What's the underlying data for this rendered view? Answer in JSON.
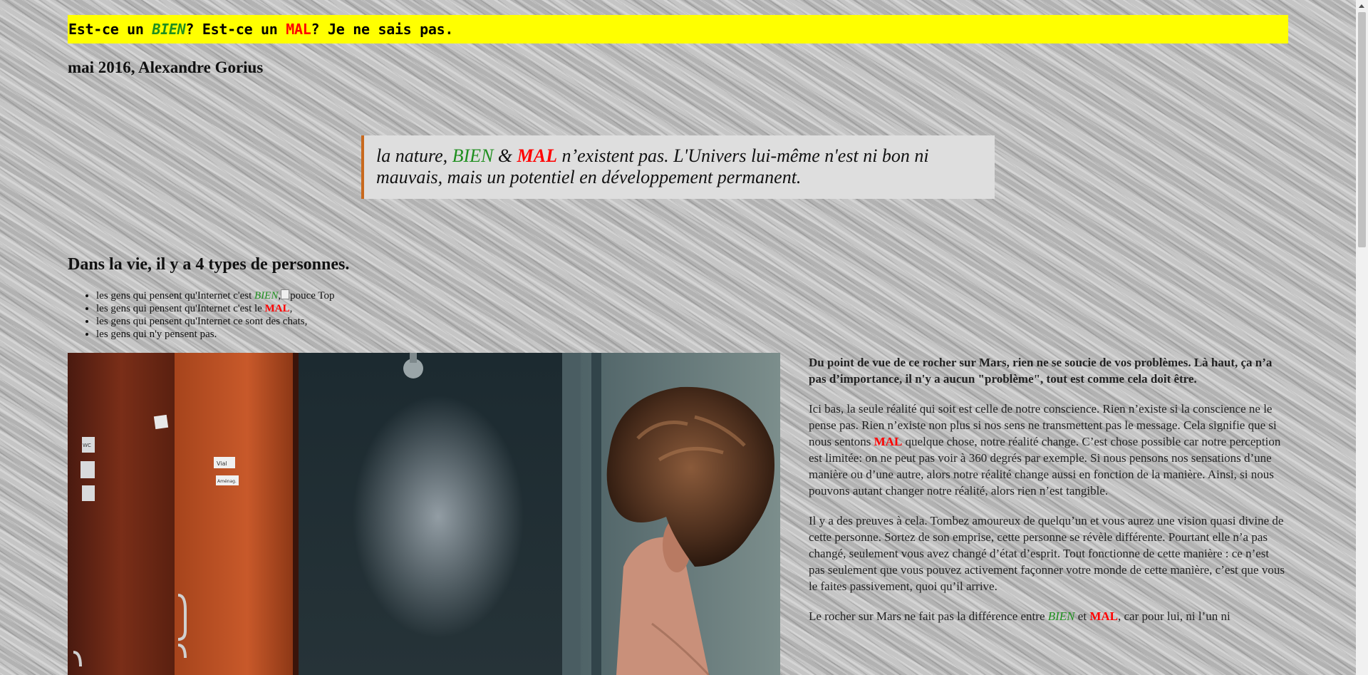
{
  "banner": {
    "part1": "Est-ce un ",
    "bien": "BIEN",
    "part2": "? Est-ce un ",
    "mal": "MAL",
    "part3": "? Je ne sais pas."
  },
  "byline": "mai 2016, Alexandre Gorius",
  "quote": {
    "part1": "la nature, ",
    "bien": "BIEN",
    "amp": " & ",
    "mal": "MAL",
    "part2": " n’existent pas. L'Univers lui-même n'est ni bon ni mauvais, mais un potentiel en développement permanent."
  },
  "section_heading": "Dans la vie, il y a 4 types de personnes.",
  "list": {
    "item1_prefix": "les gens qui pensent qu'Internet c'est ",
    "item1_bien": "BIEN",
    "item1_comma": ",",
    "item1_img_alt": "pouce Top",
    "item2_prefix": "les gens qui pensent qu'Internet c'est le ",
    "item2_mal": "MAL",
    "item2_suffix": ",",
    "item3": "les gens qui pensent qu'Internet ce sont des chats,",
    "item4": "les gens qui n'y pensent pas."
  },
  "photo": {
    "sign1": "WC",
    "sign2": "Vial",
    "sign3": "Aménag."
  },
  "article": {
    "lead": "Du point de vue de ce rocher sur Mars, rien ne se soucie de vos problèmes. Là haut, ça n’a pas d’importance, il n'y a aucun \"problème\", tout est comme cela doit être.",
    "p2_part1": "Ici bas, la seule réalité qui soit est celle de notre conscience. Rien n’existe si la conscience ne le pense pas. Rien n’existe non plus si nos sens ne transmettent pas le message. Cela signifie que si nous sentons ",
    "p2_mal": "MAL",
    "p2_part2": " quelque chose, notre réalité change. C’est chose possible car notre perception est limitée: on ne peut pas voir à 360 degrés par exemple. Si nous pensons nos sensations d’une manière ou d’une autre, alors notre réalité change aussi en fonction de la manière. Ainsi, si nous pouvons autant changer notre réalité, alors rien n’est tangible.",
    "p3": "Il y a des preuves à cela. Tombez amoureux de quelqu’un et vous aurez une vision quasi divine de cette personne. Sortez de son emprise, cette personne se révèle différente. Pourtant elle n’a pas changé, seulement vous avez changé d’état d’esprit. Tout fonctionne de cette manière : ce n’est pas seulement que vous pouvez activement façonner votre monde de cette manière, c’est que vous le faites passivement, quoi qu’il arrive.",
    "p4_part1": "Le rocher sur Mars ne fait pas la différence entre ",
    "p4_bien": "BIEN",
    "p4_and": " et ",
    "p4_mal": "MAL",
    "p4_part2": ", car pour lui, ni l’un ni"
  },
  "colors": {
    "banner_bg": "#ffff00",
    "bien": "#1f8f1f",
    "mal": "#ff0000",
    "quote_border": "#c8691e",
    "quote_bg": "#dedede"
  }
}
